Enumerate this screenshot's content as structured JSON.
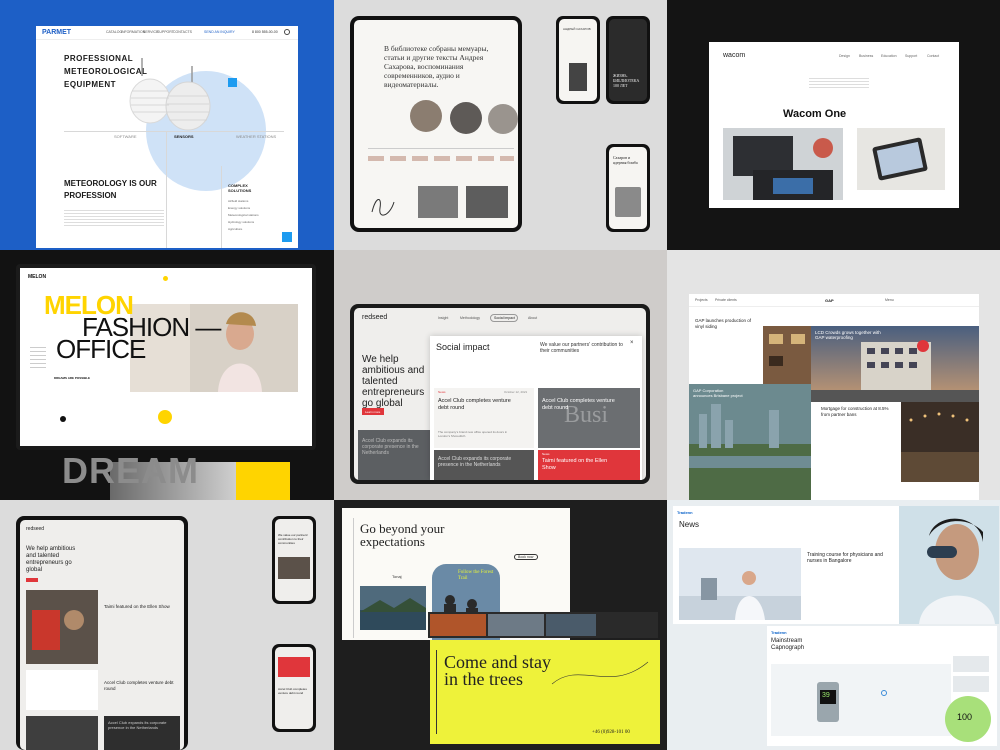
{
  "colors": {
    "parmet_blue": "#1d5fc6",
    "melon_yellow": "#ffd400",
    "redseed_red": "#e0363b",
    "lime": "#eef23a",
    "dark": "#141414"
  },
  "parmet": {
    "logo": "PARMET",
    "nav": [
      "CATALOG",
      "INFORMATION",
      "SERVICE",
      "SUPPORT",
      "CONTACTS"
    ],
    "nav_cta": "SEND AN INQUIRY",
    "phone": "8 800 555-00-00",
    "headline_1": "PROFESSIONAL",
    "headline_2": "METEOROLOGICAL",
    "headline_3": "EQUIPMENT",
    "tab_1": "SOFTWARE",
    "tab_2": "SENSORS",
    "tab_3": "WEATHER STATIONS",
    "slogan_1": "METEOROLOGY IS OUR",
    "slogan_2": "PROFESSION",
    "solutions_title_1": "COMPLEX",
    "solutions_title_2": "SOLUTIONS",
    "solutions": [
      "Airfield stations",
      "Energy solutions",
      "Meteorological stations",
      "Hydrology solutions",
      "Agriculture"
    ]
  },
  "sakharov": {
    "quote": "В библиотеке собраны мемуары, статьи и другие тексты Андрея Сахарова, воспоминания современников, аудио и видеоматериалы.",
    "phone_title": "АНДРЕЙ САХАРОВ",
    "phone2_text": "ЖИЗНЬ. БИБЛИОТЕКА 100 ЛЕТ",
    "phone3_text": "Сахаров и ядерная бомба"
  },
  "wacom": {
    "logo": "wacom",
    "product": "Wacom One",
    "menu": [
      "Design",
      "Business",
      "Education",
      "Support",
      "Contact"
    ]
  },
  "melon": {
    "logo": "MELON",
    "title_1": "MELON",
    "title_2": "FASHION —",
    "title_3": "OFFICE",
    "link": "DREAMS ARE POSSIBLE",
    "bottom": "DREAM"
  },
  "redseed": {
    "logo": "redseed",
    "nav": [
      "Insight",
      "Methodology",
      "Social impact",
      "About"
    ],
    "hero": "We help ambitious and talented entrepreneurs go global",
    "button": "Learn more",
    "panel_title": "Social impact",
    "panel_text": "We value our partners' contribution to their communities",
    "card_1_tag": "News",
    "card_1_date": "October 12, 2021",
    "card_1_title": "Accel Club completes venture debt round",
    "card_1_body": "The company's brand new office opened its doors in London's Shoreditch.",
    "card_2_title": "Accel Club completes venture debt round",
    "card_3_title": "Accel Club expands its corporate presence in the Netherlands",
    "card_4_tag": "News",
    "card_4_title": "Taimi featured on the Ellen Show",
    "big_word": "Busi"
  },
  "gap": {
    "nav_left": [
      "Projects",
      "Private clients"
    ],
    "logo": "GAP",
    "nav_right": "Menu",
    "card_1": "GAP launches production of vinyl siding",
    "card_2": "LCD Crowds grows together with GAP waterproofing",
    "card_3": "GAP Corporation announces Brisbane project",
    "card_4": "Mortgage for construction at 8.5% from partner bans"
  },
  "redseed2": {
    "logo": "redseed",
    "hero": "We help ambitious and talented entrepreneurs go global",
    "card_a": "Taimi featured on the Ellen Show",
    "card_b": "Accel Club completes venture debt round",
    "card_c": "Accel Club expands its corporate presence in the Netherlands",
    "phone_text": "We value our partners' contribution to their communities",
    "phone_card": "Accel Club completes venture debt round"
  },
  "trees": {
    "headline": "Go beyond your expectations",
    "side": "Tonaj",
    "overlay": "Follow the Forest Trail",
    "cta": "Come and stay in the trees",
    "phone": "+46 (0)928-101 00",
    "button": "Book now"
  },
  "medical": {
    "logo": "Tradenn",
    "news_title": "News",
    "news_card": "Training course for physicians and nurses in Bangalore",
    "product_title": "Mainstream Capnograph",
    "screen_value": "39",
    "gauge_value": "100"
  }
}
